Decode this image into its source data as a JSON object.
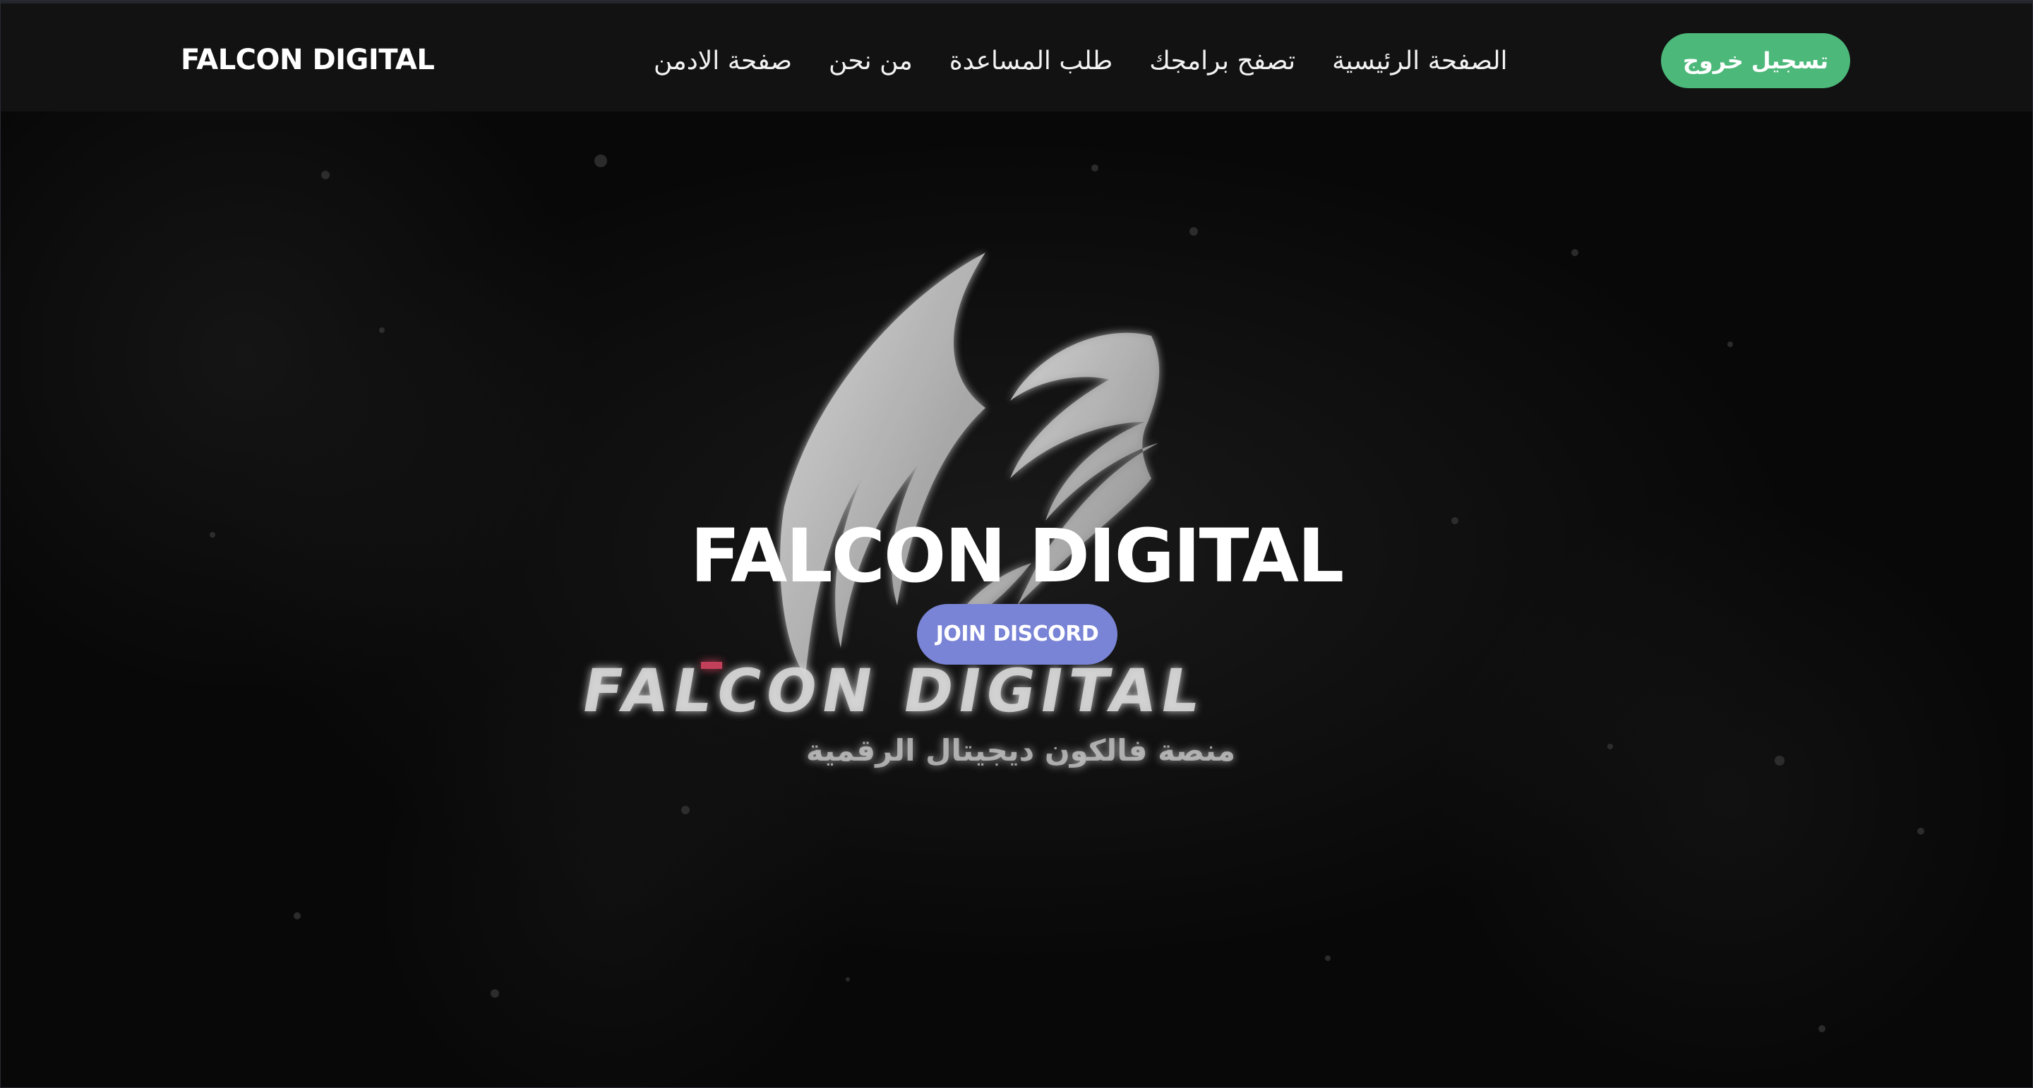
{
  "navbar": {
    "brand": "FALCON DIGITAL",
    "links": [
      {
        "label": "الصفحة الرئيسية"
      },
      {
        "label": "تصفح برامجك"
      },
      {
        "label": "طلب المساعدة"
      },
      {
        "label": "من نحن"
      },
      {
        "label": "صفحة الادمن"
      }
    ],
    "logout_label": "تسجيل خروج"
  },
  "hero": {
    "title": "FALCON DIGITAL",
    "discord_button": "JOIN DISCORD",
    "logo_text": "FALCON DIGITAL",
    "logo_subtext": "منصة فالكون ديجيتال الرقمية"
  },
  "colors": {
    "navbar_bg": "#121212",
    "logout_button": "#4cb87a",
    "discord_button": "#7984d6",
    "hero_bg": "#080808"
  }
}
